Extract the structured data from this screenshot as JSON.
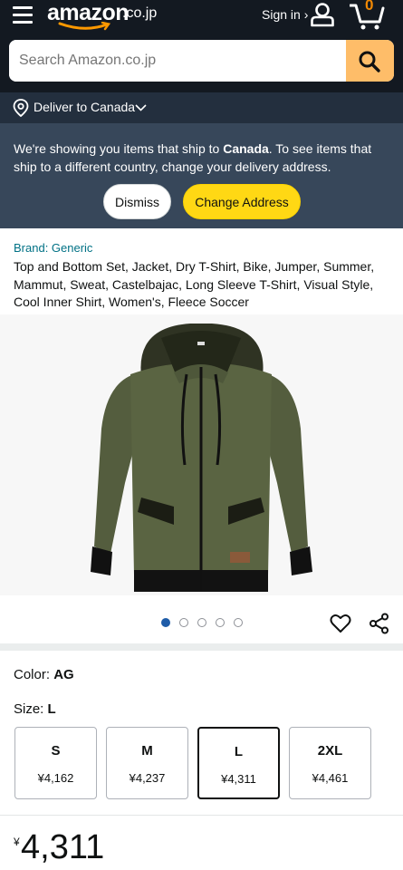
{
  "header": {
    "logo_text": "amazon",
    "logo_tld": ".co.jp",
    "signin_label": "Sign in ›",
    "cart_count": "0",
    "search_placeholder": "Search Amazon.co.jp"
  },
  "delivery": {
    "label": "Deliver to Canada"
  },
  "notice": {
    "text_before": "We're showing you items that ship to ",
    "country": "Canada",
    "text_after": ". To see items that ship to a different country, change your delivery address.",
    "dismiss_label": "Dismiss",
    "change_label": "Change Address"
  },
  "product": {
    "brand_link": "Brand: Generic",
    "title": "Top and Bottom Set, Jacket, Dry T-Shirt, Bike, Jumper, Summer, Mammut, Sweat, Castelbajac, Long Sleeve T-Shirt, Visual Style, Cool Inner Shirt, Women's, Fleece Soccer",
    "image_count": 5,
    "active_image": 1
  },
  "variants": {
    "color_label": "Color: ",
    "color_value": "AG",
    "size_label": "Size: ",
    "size_value": "L",
    "sizes": [
      {
        "name": "S",
        "price": "¥4,162"
      },
      {
        "name": "M",
        "price": "¥4,237"
      },
      {
        "name": "L",
        "price": "¥4,311"
      },
      {
        "name": "2XL",
        "price": "¥4,461"
      }
    ]
  },
  "price": {
    "symbol": "¥",
    "value": "4,311"
  },
  "colors": {
    "header_bg": "#131921",
    "deliver_bg": "#232f3e",
    "notice_bg": "#37475a",
    "accent_yellow": "#ffd814",
    "search_button": "#febd69",
    "link": "#007185",
    "active_dot": "#1e5ca8"
  },
  "icons": [
    "menu-icon",
    "amazon-smile-icon",
    "user-icon",
    "cart-icon",
    "search-icon",
    "location-pin-icon",
    "chevron-down-icon",
    "heart-icon",
    "share-icon"
  ]
}
